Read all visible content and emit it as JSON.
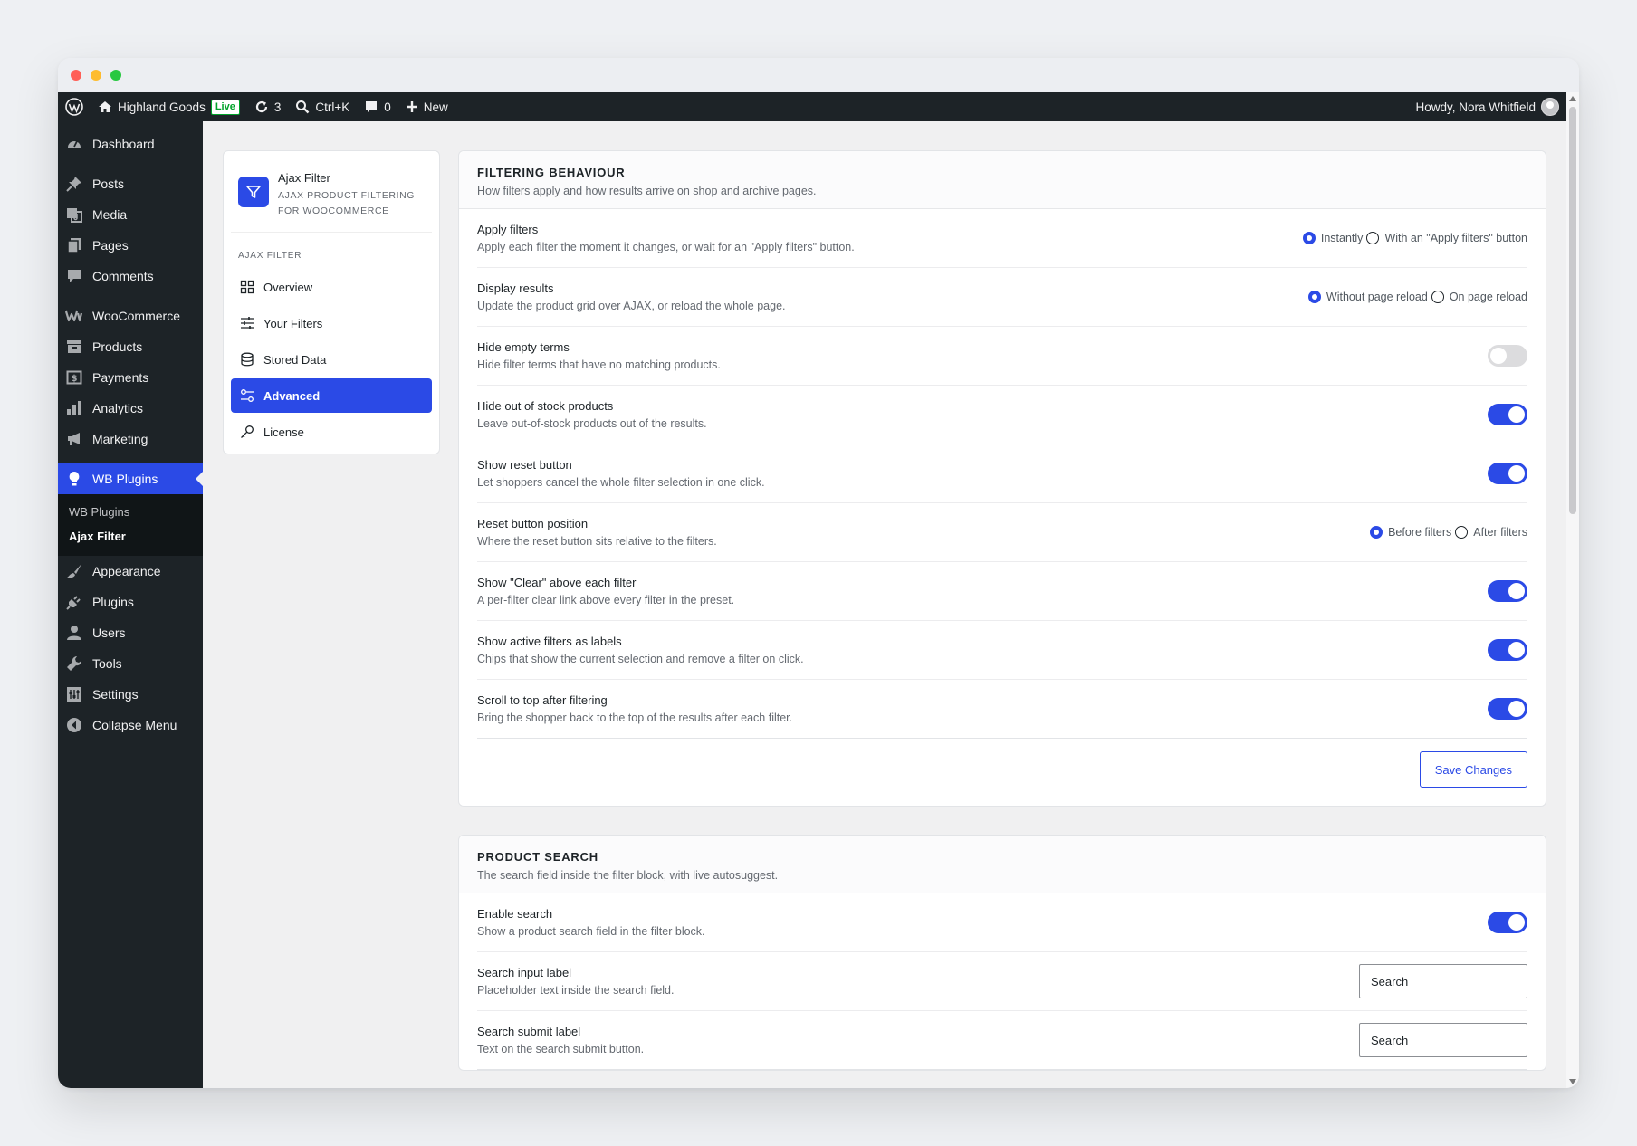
{
  "adminbar": {
    "site_name": "Highland Goods",
    "live_badge": "Live",
    "updates_count": "3",
    "search_shortcut": "Ctrl+K",
    "comments_count": "0",
    "new_label": "New",
    "howdy": "Howdy, Nora Whitfield"
  },
  "sidebar": {
    "dashboard": "Dashboard",
    "posts": "Posts",
    "media": "Media",
    "pages": "Pages",
    "comments": "Comments",
    "woocommerce": "WooCommerce",
    "products": "Products",
    "payments": "Payments",
    "analytics": "Analytics",
    "marketing": "Marketing",
    "wb_plugins": "WB Plugins",
    "sub_wb_plugins": "WB Plugins",
    "sub_ajax_filter": "Ajax Filter",
    "appearance": "Appearance",
    "plugins": "Plugins",
    "users": "Users",
    "tools": "Tools",
    "settings": "Settings",
    "collapse": "Collapse Menu"
  },
  "plugin_nav": {
    "title": "Ajax Filter",
    "subtitle_1": "AJAX PRODUCT FILTERING",
    "subtitle_2": "FOR WOOCOMMERCE",
    "section": "AJAX FILTER",
    "overview": "Overview",
    "your_filters": "Your Filters",
    "stored_data": "Stored Data",
    "advanced": "Advanced",
    "license": "License"
  },
  "filtering": {
    "title": "FILTERING BEHAVIOUR",
    "desc": "How filters apply and how results arrive on shop and archive pages.",
    "apply_filters": {
      "title": "Apply filters",
      "desc": "Apply each filter the moment it changes, or wait for an \"Apply filters\" button.",
      "opt1": "Instantly",
      "opt2": "With an \"Apply filters\" button"
    },
    "display_results": {
      "title": "Display results",
      "desc": "Update the product grid over AJAX, or reload the whole page.",
      "opt1": "Without page reload",
      "opt2": "On page reload"
    },
    "hide_empty": {
      "title": "Hide empty terms",
      "desc": "Hide filter terms that have no matching products."
    },
    "hide_oos": {
      "title": "Hide out of stock products",
      "desc": "Leave out-of-stock products out of the results."
    },
    "show_reset": {
      "title": "Show reset button",
      "desc": "Let shoppers cancel the whole filter selection in one click."
    },
    "reset_position": {
      "title": "Reset button position",
      "desc": "Where the reset button sits relative to the filters.",
      "opt1": "Before filters",
      "opt2": "After filters"
    },
    "show_clear": {
      "title": "Show \"Clear\" above each filter",
      "desc": "A per-filter clear link above every filter in the preset."
    },
    "active_labels": {
      "title": "Show active filters as labels",
      "desc": "Chips that show the current selection and remove a filter on click."
    },
    "scroll_top": {
      "title": "Scroll to top after filtering",
      "desc": "Bring the shopper back to the top of the results after each filter."
    },
    "save": "Save Changes"
  },
  "search": {
    "title": "PRODUCT SEARCH",
    "desc": "The search field inside the filter block, with live autosuggest.",
    "enable": {
      "title": "Enable search",
      "desc": "Show a product search field in the filter block."
    },
    "input_label": {
      "title": "Search input label",
      "desc": "Placeholder text inside the search field.",
      "value": "Search"
    },
    "submit_label": {
      "title": "Search submit label",
      "desc": "Text on the search submit button.",
      "value": "Search"
    }
  },
  "colors": {
    "accent": "#2b4ae6",
    "adminbar": "#1d2327"
  }
}
